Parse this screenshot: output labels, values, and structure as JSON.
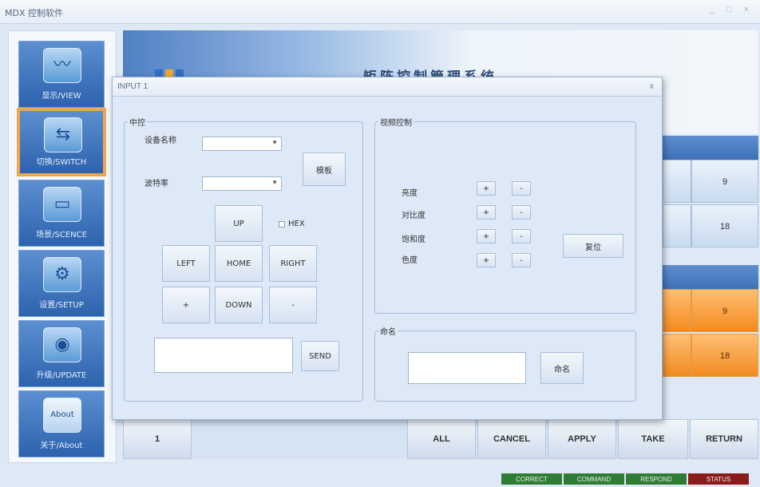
{
  "window": {
    "title": "MDX 控制软件",
    "controls": "_ □ ×"
  },
  "colors": {
    "accent": "#f0a64c",
    "nav": "#3a6fb8",
    "correct": "#2e7d32",
    "status": "#8b1a1a"
  },
  "nav": [
    {
      "label": "显示/VIEW",
      "icon": "monitor-icon",
      "glyph": "〰"
    },
    {
      "label": "切换/SWITCH",
      "icon": "switch-arrows-icon",
      "glyph": "⇆"
    },
    {
      "label": "场景/SCENCE",
      "icon": "scene-bar-icon",
      "glyph": "▭"
    },
    {
      "label": "设置/SETUP",
      "icon": "gear-icon",
      "glyph": "⚙"
    },
    {
      "label": "升级/UPDATE",
      "icon": "globe-update-icon",
      "glyph": "◉"
    },
    {
      "label": "关于/About",
      "icon": "about-icon",
      "glyph": "About"
    }
  ],
  "header": {
    "title": "矩阵控制管理系统"
  },
  "grid": {
    "row1": [
      "9",
      "18"
    ],
    "row2": [
      "9",
      "18"
    ]
  },
  "bottom": {
    "input": "1",
    "all": "ALL",
    "cancel": "CANCEL",
    "apply": "APPLY",
    "take": "TAKE",
    "ret": "RETURN"
  },
  "status": {
    "correct": "CORRECT",
    "command": "COMMAND",
    "respond": "RESPOND",
    "status": "STATUS"
  },
  "dialog": {
    "title": "INPUT 1",
    "close": "x",
    "central": {
      "legend": "中控",
      "device_label": "设备名称",
      "device_value": "",
      "baud_label": "波特率",
      "baud_value": "",
      "template": "模板",
      "up": "UP",
      "hex": "HEX",
      "left": "LEFT",
      "home": "HOME",
      "right": "RIGHT",
      "plus": "+",
      "down": "DOWN",
      "minus": "-",
      "send": "SEND",
      "command_text": ""
    },
    "video": {
      "legend": "视频控制",
      "rows": [
        {
          "label": "亮度"
        },
        {
          "label": "对比度"
        },
        {
          "label": "饱和度"
        },
        {
          "label": "色度"
        }
      ],
      "plus": "+",
      "minus": "-",
      "reset": "复位"
    },
    "naming": {
      "legend": "命名",
      "value": "",
      "button": "命名"
    }
  }
}
